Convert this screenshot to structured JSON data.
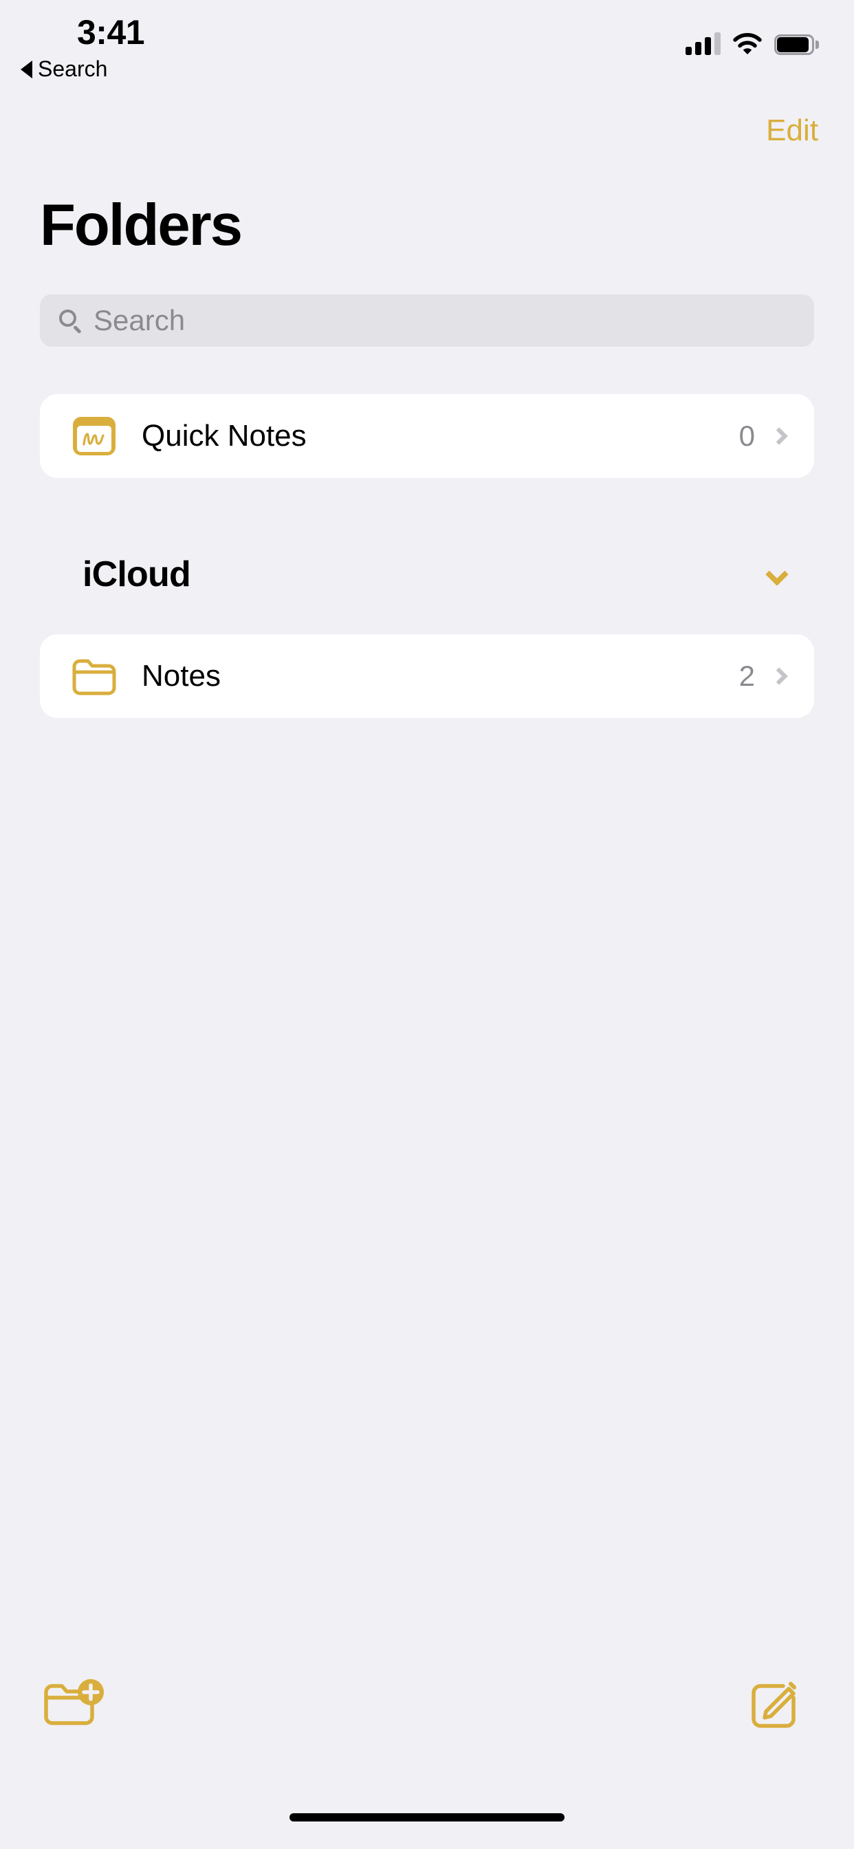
{
  "status_bar": {
    "time": "3:41",
    "signal_icon": "cellular-signal-icon",
    "wifi_icon": "wifi-icon",
    "battery_icon": "battery-icon"
  },
  "back_to_app": {
    "label": "Search",
    "icon": "back-triangle-icon"
  },
  "nav": {
    "edit_label": "Edit"
  },
  "header": {
    "title": "Folders"
  },
  "search": {
    "placeholder": "Search",
    "value": "",
    "icon": "search-icon"
  },
  "quick_notes": {
    "label": "Quick Notes",
    "count": "0",
    "icon": "quick-notes-icon",
    "chevron": "chevron-right-icon"
  },
  "sections": [
    {
      "title": "iCloud",
      "collapse_icon": "chevron-down-icon",
      "items": [
        {
          "label": "Notes",
          "count": "2",
          "icon": "folder-icon",
          "chevron": "chevron-right-icon"
        }
      ]
    }
  ],
  "toolbar": {
    "new_folder_icon": "new-folder-icon",
    "compose_icon": "compose-note-icon"
  },
  "colors": {
    "accent": "#D9AE3C",
    "background": "#F1F0F5",
    "card": "#FFFFFF",
    "search_field": "#E3E2E7",
    "secondary_text": "#8A8A8F"
  }
}
